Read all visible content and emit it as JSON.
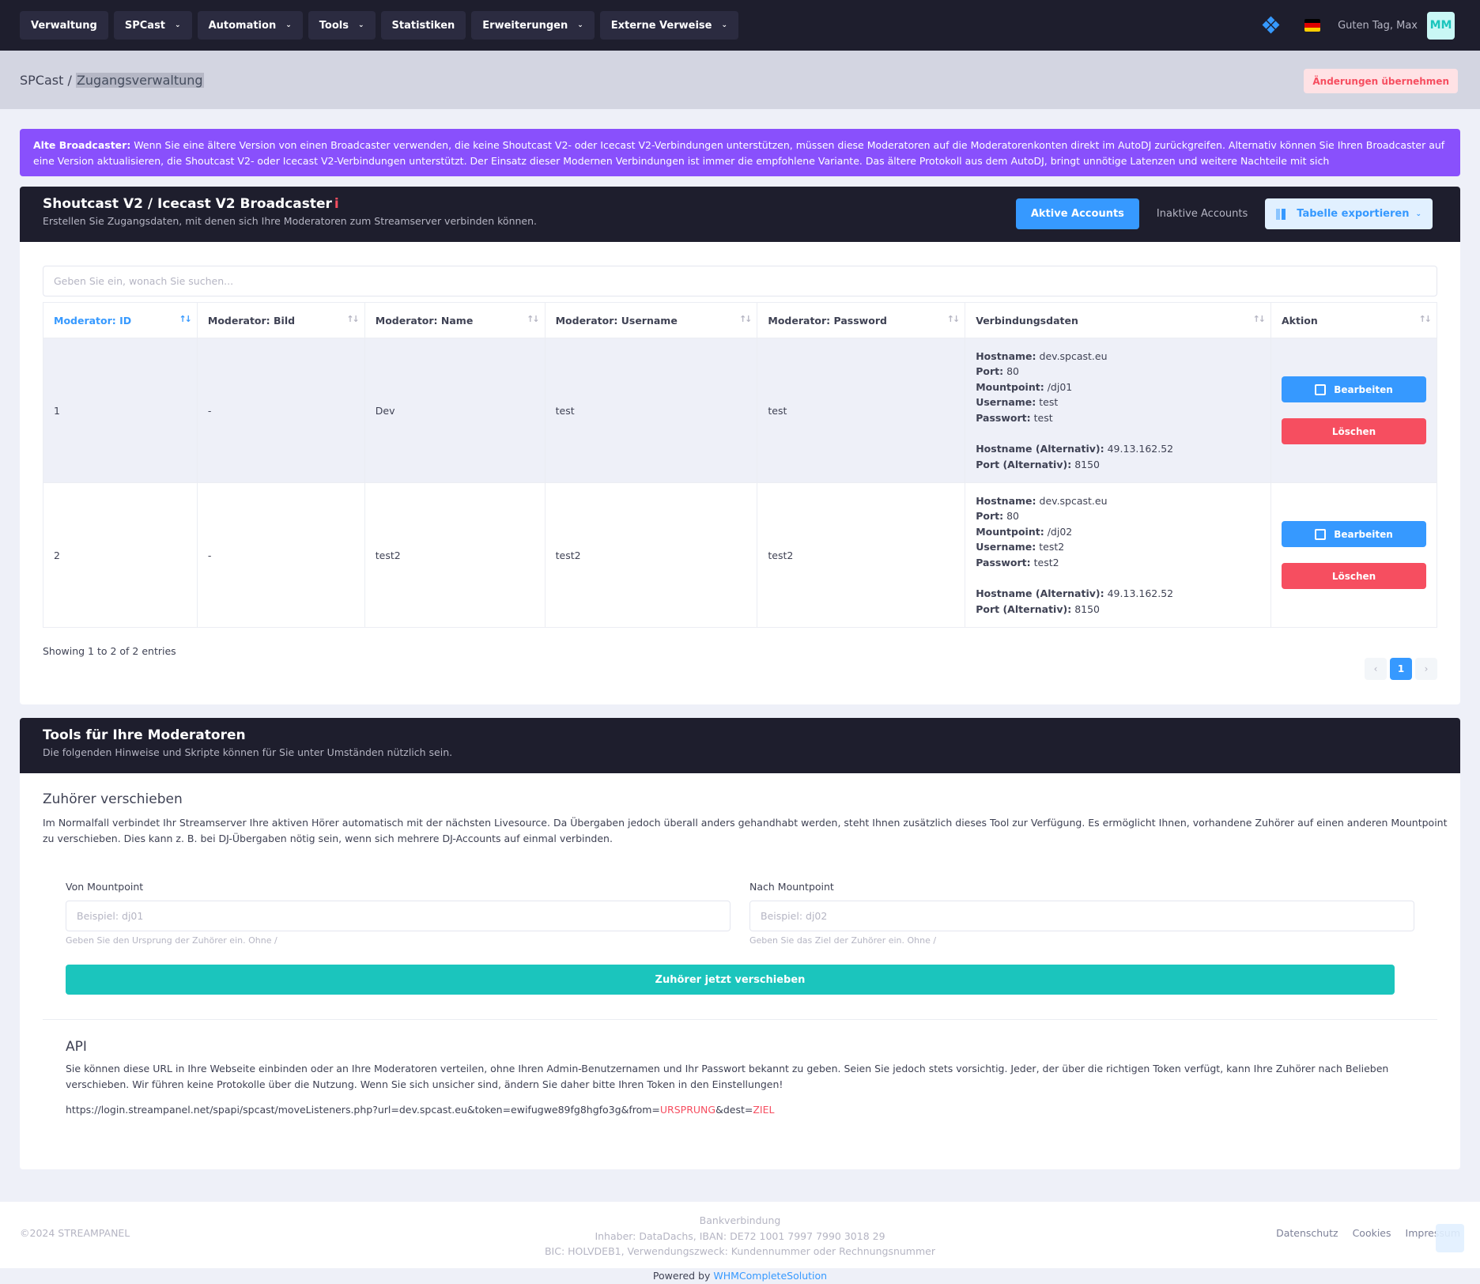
{
  "nav": {
    "items": [
      {
        "label": "Verwaltung",
        "dropdown": false
      },
      {
        "label": "SPCast",
        "dropdown": true
      },
      {
        "label": "Automation",
        "dropdown": true
      },
      {
        "label": "Tools",
        "dropdown": true
      },
      {
        "label": "Statistiken",
        "dropdown": false
      },
      {
        "label": "Erweiterungen",
        "dropdown": true
      },
      {
        "label": "Externe Verweise",
        "dropdown": true
      }
    ],
    "greeting": "Guten Tag, Max",
    "avatar_initials": "MM"
  },
  "subheader": {
    "crumb_root": "SPCast",
    "crumb_sep": " / ",
    "crumb_current": "Zugangsverwaltung",
    "apply_button": "Änderungen übernehmen"
  },
  "alert": {
    "strong": "Alte Broadcaster:",
    "text": " Wenn Sie eine ältere Version von einen Broadcaster verwenden, die keine Shoutcast V2- oder Icecast V2-Verbindungen unterstützen, müssen diese Moderatoren auf die Moderatorenkonten direkt im AutoDJ zurückgreifen. Alternativ können Sie Ihren Broadcaster auf eine Version aktualisieren, die Shoutcast V2- oder Icecast V2-Verbindungen unterstützt. Der Einsatz dieser Modernen Verbindungen ist immer die empfohlene Variante. Das ältere Protokoll aus dem AutoDJ, bringt unnötige Latenzen und weitere Nachteile mit sich"
  },
  "broadcaster": {
    "title": "Shoutcast V2 / Icecast V2 Broadcaster",
    "info_glyph": "i",
    "subtitle": "Erstellen Sie Zugangsdaten, mit denen sich Ihre Moderatoren zum Streamserver verbinden können.",
    "active_button": "Aktive Accounts",
    "inactive_button": "Inaktive Accounts",
    "export_button": "Tabelle exportieren",
    "search_placeholder": "Geben Sie ein, wonach Sie suchen...",
    "columns": [
      "Moderator: ID",
      "Moderator: Bild",
      "Moderator: Name",
      "Moderator: Username",
      "Moderator: Password",
      "Verbindungsdaten",
      "Aktion"
    ],
    "rows": [
      {
        "id": "1",
        "bild": "-",
        "name": "Dev",
        "username": "test",
        "password": "test",
        "conn": [
          {
            "k": "Hostname:",
            "v": "dev.spcast.eu"
          },
          {
            "k": "Port:",
            "v": "80"
          },
          {
            "k": "Mountpoint:",
            "v": "/dj01"
          },
          {
            "k": "Username:",
            "v": "test"
          },
          {
            "k": "Passwort:",
            "v": "test"
          },
          {
            "k": "",
            "v": ""
          },
          {
            "k": "Hostname (Alternativ):",
            "v": "49.13.162.52"
          },
          {
            "k": "Port (Alternativ):",
            "v": "8150"
          }
        ]
      },
      {
        "id": "2",
        "bild": "-",
        "name": "test2",
        "username": "test2",
        "password": "test2",
        "conn": [
          {
            "k": "Hostname:",
            "v": "dev.spcast.eu"
          },
          {
            "k": "Port:",
            "v": "80"
          },
          {
            "k": "Mountpoint:",
            "v": "/dj02"
          },
          {
            "k": "Username:",
            "v": "test2"
          },
          {
            "k": "Passwort:",
            "v": "test2"
          },
          {
            "k": "",
            "v": ""
          },
          {
            "k": "Hostname (Alternativ):",
            "v": "49.13.162.52"
          },
          {
            "k": "Port (Alternativ):",
            "v": "8150"
          }
        ]
      }
    ],
    "edit_label": "Bearbeiten",
    "delete_label": "Löschen",
    "showing": "Showing 1 to 2 of 2 entries",
    "page_prev": "‹",
    "page_current": "1",
    "page_next": "›"
  },
  "tools": {
    "title": "Tools für Ihre Moderatoren",
    "subtitle": "Die folgenden Hinweise und Skripte können für Sie unter Umständen nützlich sein.",
    "move_title": "Zuhörer verschieben",
    "move_text": "Im Normalfall verbindet Ihr Streamserver Ihre aktiven Hörer automatisch mit der nächsten Livesource. Da Übergaben jedoch überall anders gehandhabt werden, steht Ihnen zusätzlich dieses Tool zur Verfügung. Es ermöglicht Ihnen, vorhandene Zuhörer auf einen anderen Mountpoint zu verschieben. Dies kann z. B. bei DJ-Übergaben nötig sein, wenn sich mehrere DJ-Accounts auf einmal verbinden.",
    "from_label": "Von Mountpoint",
    "from_placeholder": "Beispiel: dj01",
    "from_hint": "Geben Sie den Ursprung der Zuhörer ein. Ohne /",
    "to_label": "Nach Mountpoint",
    "to_placeholder": "Beispiel: dj02",
    "to_hint": "Geben Sie das Ziel der Zuhörer ein. Ohne /",
    "move_button": "Zuhörer jetzt verschieben",
    "api_title": "API",
    "api_text": "Sie können diese URL in Ihre Webseite einbinden oder an Ihre Moderatoren verteilen, ohne Ihren Admin-Benutzernamen und Ihr Passwort bekannt zu geben. Seien Sie jedoch stets vorsichtig. Jeder, der über die richtigen Token verfügt, kann Ihre Zuhörer nach Belieben verschieben. Wir führen keine Protokolle über die Nutzung. Wenn Sie sich unsicher sind, ändern Sie daher bitte Ihren Token in den Einstellungen!",
    "api_url_base": "https://login.streampanel.net/spapi/spcast/moveListeners.php?url=dev.spcast.eu&token=ewifugwe89fg8hgfo3g&from=",
    "api_url_from": "URSPRUNG",
    "api_url_mid": "&dest=",
    "api_url_dest": "ZIEL"
  },
  "footer": {
    "copyright": "©2024 STREAMPANEL",
    "bank_title": "Bankverbindung",
    "bank_line1": "Inhaber: DataDachs, IBAN: DE72 1001 7997 7990 3018 29",
    "bank_line2": "BIC: HOLVDEB1, Verwendungszweck: Kundennummer oder Rechnungsnummer",
    "links": [
      "Datenschutz",
      "Cookies",
      "Impressum"
    ],
    "powered_prefix": "Powered by ",
    "powered_link": "WHMCompleteSolution"
  },
  "colors": {
    "nav_bg": "#1e1e2d",
    "primary": "#3699ff",
    "danger": "#f64e60",
    "teal": "#1bc5bd",
    "purple": "#8950fc"
  }
}
